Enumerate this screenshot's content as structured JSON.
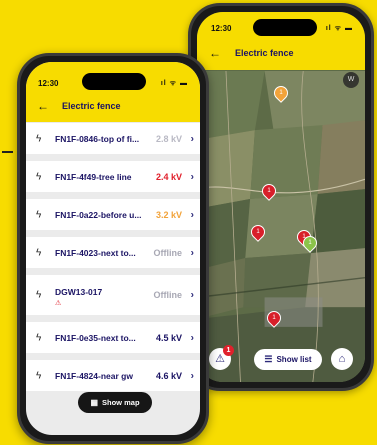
{
  "back_phone": {
    "status_time": "12:30",
    "title": "Electric fence",
    "compass_label": "W",
    "pins": [
      {
        "label": "1",
        "color": "#f2a33a"
      },
      {
        "label": "1",
        "color": "#d81f2a"
      },
      {
        "label": "1",
        "color": "#d81f2a"
      },
      {
        "label": "1",
        "color": "#d81f2a"
      },
      {
        "label": "1",
        "color": "#8bc34a"
      },
      {
        "label": "1",
        "color": "#d81f2a"
      }
    ],
    "alarm_badge": "1",
    "show_list_label": "Show list"
  },
  "front_phone": {
    "status_time": "12:30",
    "title": "Electric fence",
    "fences": [
      {
        "name": "FN1F-0846-top of fi...",
        "value": "2.8 kV",
        "value_color": "#b9b9c4"
      },
      {
        "name": "FN1F-4f49-tree line",
        "value": "2.4 kV",
        "value_color": "#e0202b"
      },
      {
        "name": "FN1F-0a22-before u...",
        "value": "3.2 kV",
        "value_color": "#f2a33a"
      },
      {
        "name": "FN1F-4023-next to...",
        "value": "Offline",
        "value_color": "#a8a8b4"
      },
      {
        "name": "DGW13-017",
        "value": "Offline",
        "value_color": "#a8a8b4"
      },
      {
        "name": "FN1F-0e35-next to...",
        "value": "4.5 kV",
        "value_color": "#1b1464"
      },
      {
        "name": "FN1F-4824-near gw",
        "value": "4.6 kV",
        "value_color": "#1b1464"
      }
    ],
    "show_map_label": "Show map"
  },
  "colors": {
    "brand_yellow": "#f7dc00",
    "navy": "#1b1464",
    "alert_red": "#e0202b"
  }
}
